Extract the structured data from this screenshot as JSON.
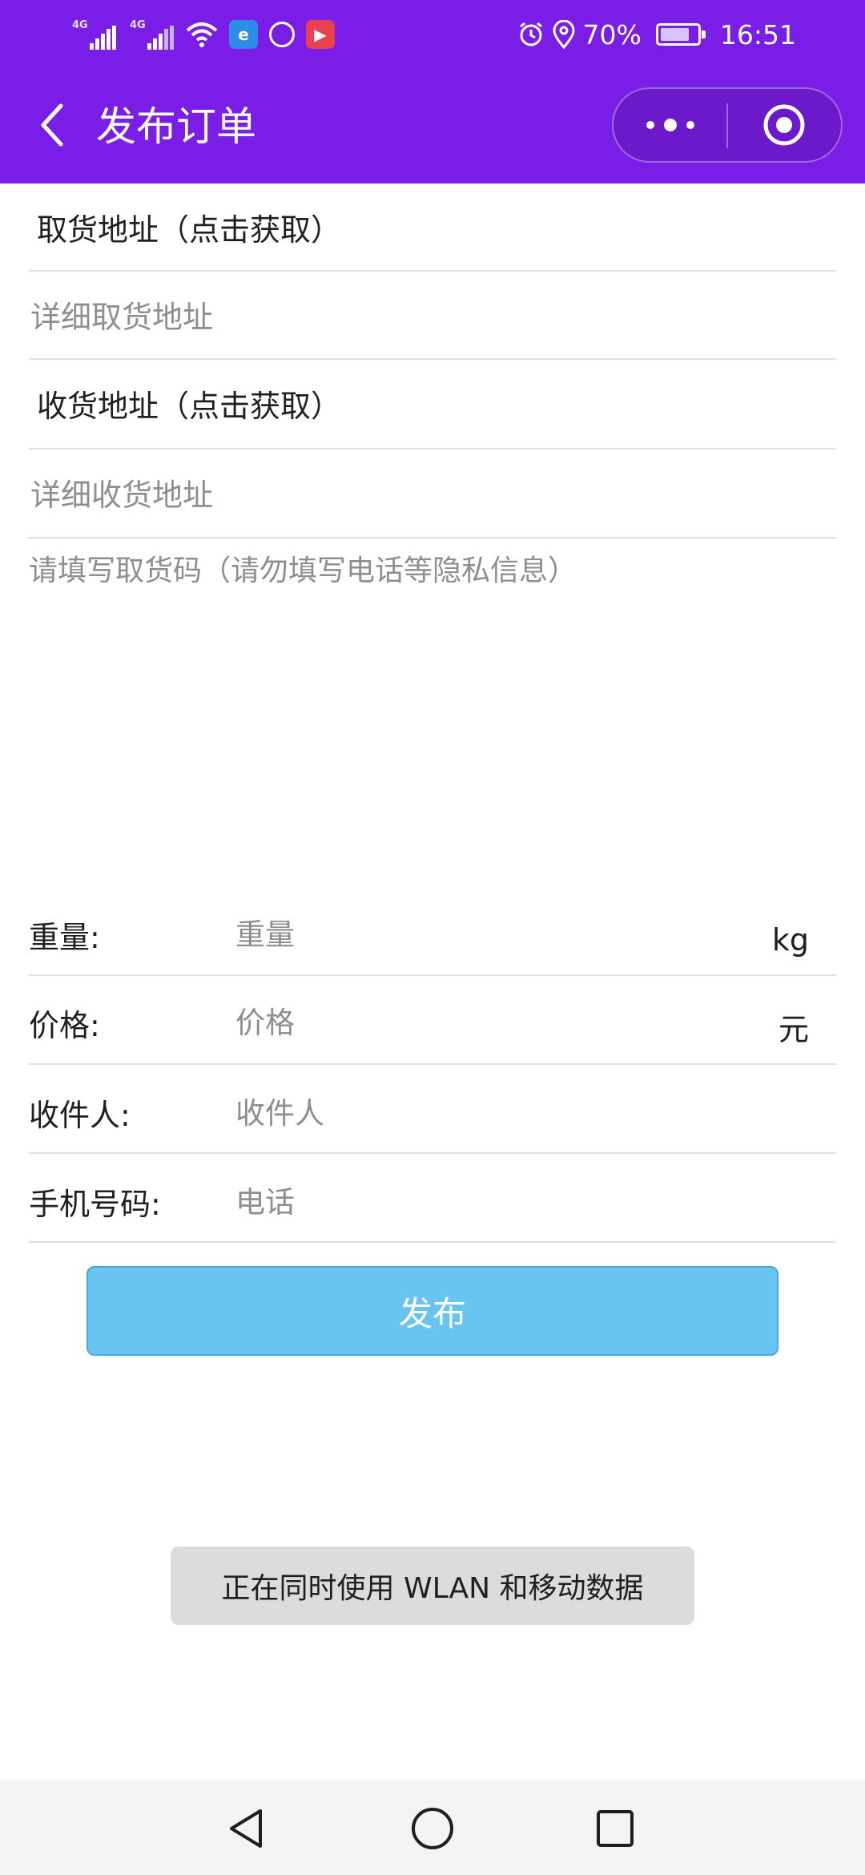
{
  "status_bar": {
    "network_1": "4G",
    "network_2": "4G",
    "battery_text": "70%",
    "battery_level": 0.7,
    "time": "16:51"
  },
  "header": {
    "title": "发布订单",
    "accent_color": "#7a1de6"
  },
  "form": {
    "pickup_address": "取货地址（点击获取）",
    "pickup_detail_placeholder": "详细取货地址",
    "delivery_address": "收货地址（点击获取）",
    "delivery_detail_placeholder": "详细收货地址",
    "pickup_code_placeholder": "请填写取货码（请勿填写电话等隐私信息）",
    "weight_label": "重量:",
    "weight_placeholder": "重量",
    "weight_unit": "kg",
    "price_label": "价格:",
    "price_placeholder": "价格",
    "price_unit": "元",
    "receiver_label": "收件人:",
    "receiver_placeholder": "收件人",
    "phone_label": "手机号码:",
    "phone_placeholder": "电话",
    "submit_label": "发布",
    "submit_color": "#69c4f2"
  },
  "toast": {
    "text": "正在同时使用 WLAN 和移动数据"
  },
  "icons": {
    "status_left": [
      "signal-icon",
      "signal-icon",
      "wifi-icon",
      "app-notification-icon",
      "app-notification-icon",
      "app-notification-icon"
    ],
    "status_right": [
      "alarm-icon",
      "location-icon",
      "battery-icon"
    ],
    "header": [
      "back-arrow-icon",
      "more-dots-icon",
      "target-circle-icon"
    ],
    "nav": [
      "nav-back-icon",
      "nav-home-icon",
      "nav-recents-icon"
    ]
  }
}
